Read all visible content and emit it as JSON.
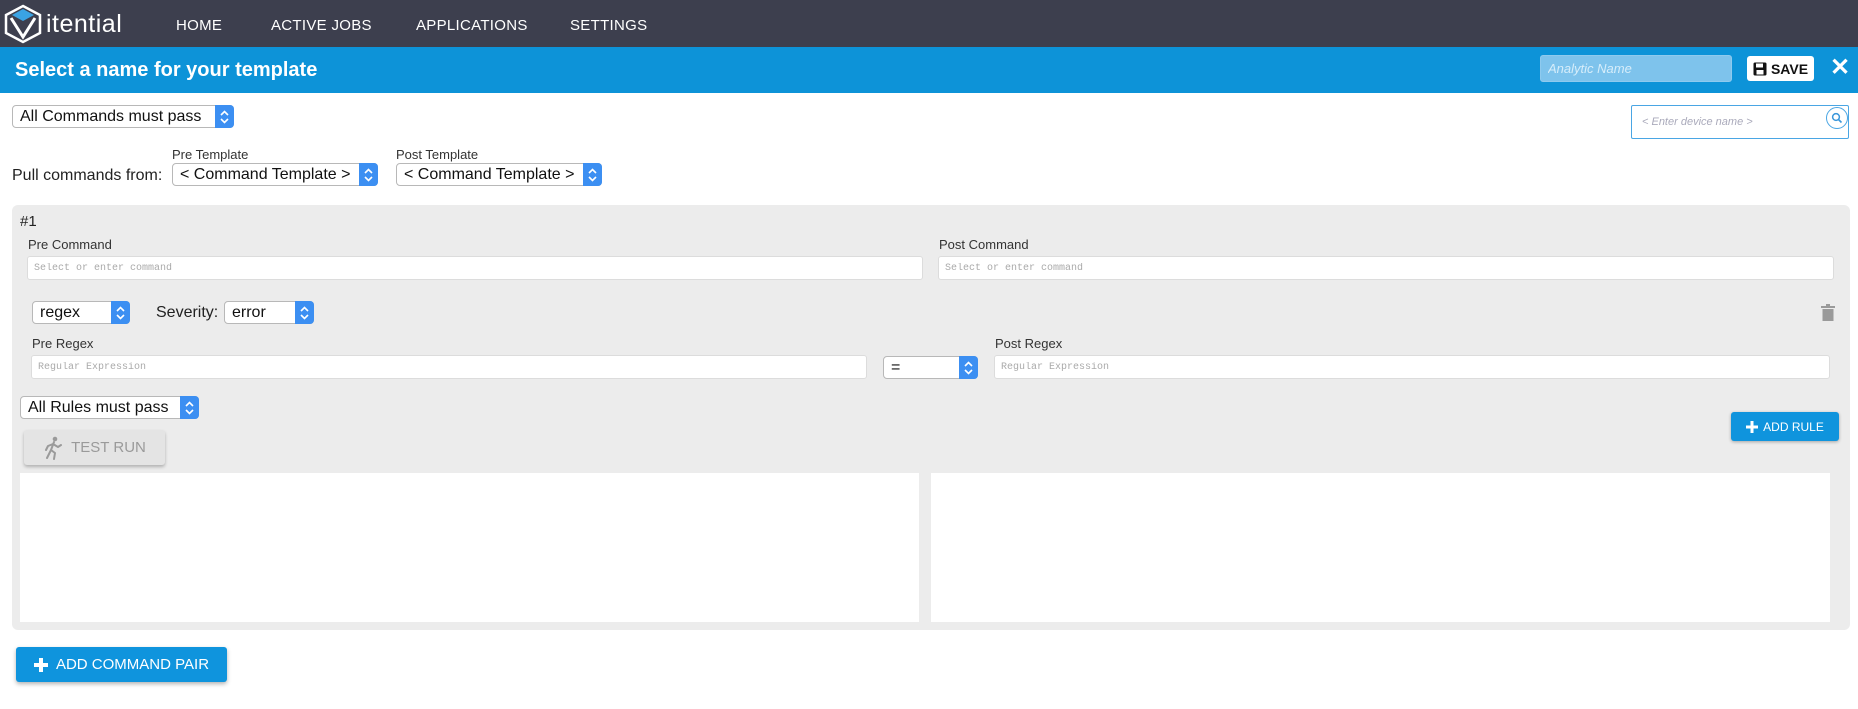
{
  "brand": {
    "logo_text": "itential"
  },
  "nav": {
    "items": [
      "HOME",
      "ACTIVE JOBS",
      "APPLICATIONS",
      "SETTINGS"
    ]
  },
  "titlebar": {
    "title": "Select a name for your template",
    "analytic_placeholder": "Analytic Name",
    "save_label": "SAVE",
    "close_glyph": "✕"
  },
  "controls": {
    "pass_mode": "All Commands must pass",
    "device_placeholder": "< Enter device name >",
    "pull_label": "Pull commands from:",
    "pre_template_label": "Pre Template",
    "pre_template_value": "< Command Template >",
    "post_template_label": "Post Template",
    "post_template_value": "< Command Template >"
  },
  "pair": {
    "number": "#1",
    "pre_command_label": "Pre Command",
    "pre_command_placeholder": "Select or enter command",
    "post_command_label": "Post Command",
    "post_command_placeholder": "Select or enter command",
    "rule_type": "regex",
    "severity_label": "Severity:",
    "severity_value": "error",
    "pre_regex_label": "Pre Regex",
    "pre_regex_placeholder": "Regular Expression",
    "operator": "=",
    "post_regex_label": "Post Regex",
    "post_regex_placeholder": "Regular Expression",
    "rules_mode": "All Rules must pass",
    "add_rule_label": "ADD RULE",
    "test_run_label": "TEST RUN"
  },
  "footer": {
    "add_pair_label": "ADD COMMAND PAIR"
  },
  "colors": {
    "nav_bg": "#3d3f4e",
    "accent": "#0d93d8",
    "select_arrow": "#3c8ff2",
    "panel_bg": "#ececec"
  },
  "icons": [
    "itential-logo",
    "save-disk-icon",
    "close-icon",
    "search-icon",
    "trash-icon",
    "running-man-icon",
    "plus-icon"
  ]
}
